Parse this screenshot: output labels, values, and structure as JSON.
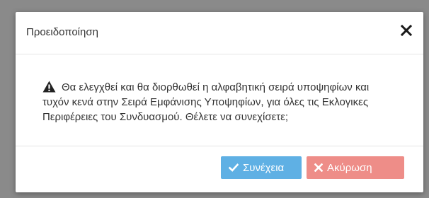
{
  "dialog": {
    "title": "Προειδοποίηση",
    "close_icon": "close-icon",
    "message": "Θα ελεγχθεί και θα διορθωθεί η αλφαβητική σειρά υποψηφίων και τυχόν κενά στην Σειρά Εμφάνισης Υποψηφίων, για όλες τις Εκλογικες Περιφέρειες του Συνδυασμού. Θέλετε να συνεχίσετε;",
    "warning_icon": "warning-icon"
  },
  "buttons": {
    "continue_label": "Συνέχεια",
    "continue_icon": "check-icon",
    "continue_color": "#5fb0e4",
    "cancel_label": "Ακύρωση",
    "cancel_icon": "times-icon",
    "cancel_color": "#ee8d88"
  }
}
